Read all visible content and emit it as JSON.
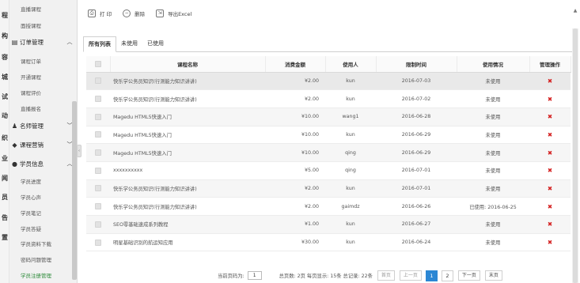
{
  "far_left": [
    "程",
    "构",
    "容",
    "城",
    "试",
    "动",
    "织",
    "业",
    "闻",
    "员",
    "告",
    "置"
  ],
  "sidebar": {
    "top_items": [
      "直播课程",
      "面授课程"
    ],
    "groups": [
      {
        "label": "订单管理",
        "items": [
          "课程订单",
          "开通课程",
          "课程评价",
          "直播报名"
        ]
      },
      {
        "label": "名师管理",
        "items": []
      },
      {
        "label": "课程营销",
        "items": []
      },
      {
        "label": "学员信息",
        "items": [
          "学员进度",
          "学员心声",
          "学员笔记",
          "学员答疑",
          "学员资料下载",
          "密码问题管理",
          "学员注册管理"
        ]
      }
    ]
  },
  "toolbar": {
    "print_label": "打 印",
    "delete_label": "删除",
    "export_label": "导出Excel"
  },
  "tabs": [
    "所有列表",
    "未使用",
    "已使用"
  ],
  "table": {
    "headers": [
      "",
      "课程名称",
      "消费金额",
      "使用人",
      "限制时间",
      "使用情况",
      "管理操作"
    ],
    "rows": [
      {
        "name": "快乐学公务员知识(行测能力知识讲讲)",
        "price": "¥2.00",
        "user": "kun",
        "date": "2016-07-03",
        "status": "未使用",
        "used": false
      },
      {
        "name": "快乐学公务员知识(行测能力知识讲讲)",
        "price": "¥2.00",
        "user": "kun",
        "date": "2016-07-02",
        "status": "未使用",
        "used": false
      },
      {
        "name": "Magedu HTML5快速入门",
        "price": "¥10.00",
        "user": "wang1",
        "date": "2016-06-28",
        "status": "未使用",
        "used": false
      },
      {
        "name": "Magedu HTML5快速入门",
        "price": "¥10.00",
        "user": "kun",
        "date": "2016-06-29",
        "status": "未使用",
        "used": false
      },
      {
        "name": "Magedu HTML5快速入门",
        "price": "¥10.00",
        "user": "qing",
        "date": "2016-06-29",
        "status": "未使用",
        "used": false
      },
      {
        "name": "xxxxxxxxxx",
        "price": "¥5.00",
        "user": "qing",
        "date": "2016-07-01",
        "status": "未使用",
        "used": false
      },
      {
        "name": "快乐学公务员知识(行测能力知识讲讲)",
        "price": "¥2.00",
        "user": "kun",
        "date": "2016-07-01",
        "status": "未使用",
        "used": false
      },
      {
        "name": "快乐学公务员知识(行测能力知识讲讲)",
        "price": "¥2.00",
        "user": "gaimdz",
        "date": "2016-06-26",
        "status": "已使用: 2016-06-25",
        "used": true
      },
      {
        "name": "SEO零基础速成系列教程",
        "price": "¥1.00",
        "user": "kun",
        "date": "2016-06-27",
        "status": "未使用",
        "used": false
      },
      {
        "name": "明星基础识别的航运知应用",
        "price": "¥30.00",
        "user": "kun",
        "date": "2016-06-24",
        "status": "未使用",
        "used": false
      }
    ],
    "delete_glyph": "✖"
  },
  "pager": {
    "goto_label": "当前页码为:",
    "goto_value": "1",
    "stats": "总页数: 2页  每页显示: 15条  总记录: 22条",
    "first": "首页",
    "prev": "上一页",
    "pages": [
      "1",
      "2"
    ],
    "next": "下一页",
    "last": "末页"
  },
  "colors": {
    "accent": "#2c87d4",
    "delete": "#d42020",
    "active_menu": "#2e8b3a"
  }
}
